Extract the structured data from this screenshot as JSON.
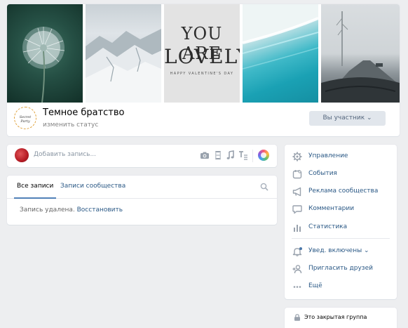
{
  "cover": {
    "photos": [
      {
        "name": "dandelion"
      },
      {
        "name": "snowy-hills"
      },
      {
        "name": "you-are-lovely",
        "text_line1": "YOU ARE",
        "text_line2": "LOVELY",
        "text_line3": "HAPPY VALENTINE'S DAY"
      },
      {
        "name": "ocean-shore"
      },
      {
        "name": "foggy-road"
      }
    ]
  },
  "group": {
    "avatar_text": "Secret Party",
    "name": "Темное братство",
    "status": "изменить статус",
    "member_button": "Вы участник ⌄"
  },
  "composer": {
    "placeholder": "Добавить запись...",
    "tools": [
      "camera-icon",
      "film-icon",
      "music-note-icon",
      "text-format-icon",
      "theme-icon"
    ]
  },
  "wall": {
    "tabs": [
      {
        "label": "Все записи",
        "active": true
      },
      {
        "label": "Записи сообщества",
        "active": false
      }
    ],
    "deleted_text": "Запись удалена.",
    "restore_link": "Восстановить"
  },
  "menu": {
    "items": [
      {
        "label": "Управление",
        "icon": "gear-icon"
      },
      {
        "label": "События",
        "icon": "calendar-icon"
      },
      {
        "label": "Реклама сообщества",
        "icon": "megaphone-icon"
      },
      {
        "label": "Комментарии",
        "icon": "comment-icon"
      },
      {
        "label": "Статистика",
        "icon": "stats-icon"
      },
      {
        "label": "Увед. включены ⌄",
        "icon": "bell-icon"
      },
      {
        "label": "Пригласить друзей",
        "icon": "add-user-icon"
      },
      {
        "label": "Ещё",
        "icon": "more-icon"
      }
    ]
  },
  "closed_group": {
    "label": "Это закрытая группа",
    "icon": "lock-icon"
  },
  "colors": {
    "background": "#edeef0",
    "link": "#2a5885",
    "accent": "#5181b8",
    "icon": "#99a2ad"
  }
}
